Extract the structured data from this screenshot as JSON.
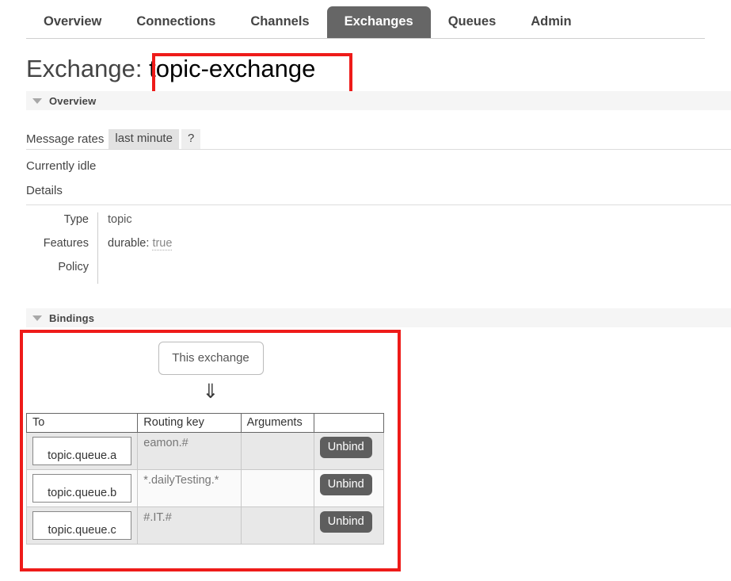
{
  "nav": {
    "tabs": [
      {
        "label": "Overview",
        "active": false
      },
      {
        "label": "Connections",
        "active": false
      },
      {
        "label": "Channels",
        "active": false
      },
      {
        "label": "Exchanges",
        "active": true
      },
      {
        "label": "Queues",
        "active": false
      },
      {
        "label": "Admin",
        "active": false
      }
    ]
  },
  "page": {
    "title_prefix": "Exchange:",
    "exchange_name": "topic-exchange"
  },
  "overview": {
    "section_label": "Overview",
    "message_rates_label": "Message rates",
    "rate_period_tab": "last minute",
    "help_tab": "?",
    "idle_text": "Currently idle",
    "details_label": "Details",
    "details": [
      {
        "key": "Type",
        "value": "topic"
      },
      {
        "key": "Features",
        "value_label": "durable:",
        "value": "true"
      },
      {
        "key": "Policy",
        "value": ""
      }
    ]
  },
  "bindings": {
    "section_label": "Bindings",
    "source_box_label": "This exchange",
    "arrow_glyph": "⇓",
    "columns": [
      "To",
      "Routing key",
      "Arguments",
      ""
    ],
    "rows": [
      {
        "to": "topic.queue.a",
        "routing_key": "eamon.#",
        "arguments": "",
        "action": "Unbind"
      },
      {
        "to": "topic.queue.b",
        "routing_key": "*.dailyTesting.*",
        "arguments": "",
        "action": "Unbind"
      },
      {
        "to": "topic.queue.c",
        "routing_key": "#.IT.#",
        "arguments": "",
        "action": "Unbind"
      }
    ]
  },
  "annotations": {
    "accent_color": "#ee1b19",
    "title_highlight": "topic-exchange",
    "bindings_highlight": "Bindings"
  }
}
